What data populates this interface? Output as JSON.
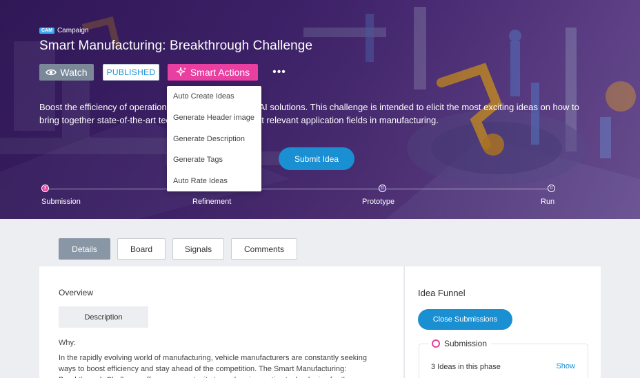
{
  "hero": {
    "cam_badge": "CAM",
    "campaign_label": "Campaign",
    "title": "Smart Manufacturing: Breakthrough Challenge",
    "watch_label": "Watch",
    "status_badge": "PUBLISHED",
    "smart_actions_label": "Smart Actions",
    "more_label": "•••",
    "description": "Boost the efficiency of operations with cutting-edge ML/AI solutions. This challenge is intended to elicit the most exciting ideas on how to bring together state-of-the-art technologies with the most relevant application fields in manufacturing.",
    "submit_label": "Submit Idea",
    "colors": {
      "accent_pink": "#e83fa0",
      "primary_blue": "#1a8fd2"
    }
  },
  "smart_actions_menu": {
    "items": [
      {
        "label": "Auto Create Ideas"
      },
      {
        "label": "Generate Header image"
      },
      {
        "label": "Generate Description"
      },
      {
        "label": "Generate Tags"
      },
      {
        "label": "Auto Rate Ideas"
      }
    ]
  },
  "phases": [
    {
      "count": "3",
      "label": "Submission"
    },
    {
      "count": "",
      "label": "Refinement"
    },
    {
      "count": "0",
      "label": "Prototype"
    },
    {
      "count": "0",
      "label": "Run"
    }
  ],
  "tabs": [
    {
      "label": "Details"
    },
    {
      "label": "Board"
    },
    {
      "label": "Signals"
    },
    {
      "label": "Comments"
    }
  ],
  "overview": {
    "heading": "Overview",
    "description_button": "Description",
    "why_label": "Why:",
    "body": "In the rapidly evolving world of manufacturing, vehicle manufacturers are constantly seeking ways to boost efficiency and stay ahead of the competition. The Smart Manufacturing: Breakthrough Challenge offers an opportunity to explore innovative technologies for the production"
  },
  "funnel": {
    "heading": "Idea Funnel",
    "close_button": "Close Submissions",
    "phase_label": "Submission",
    "ideas_count": "3 Ideas in this phase",
    "show_link": "Show"
  }
}
